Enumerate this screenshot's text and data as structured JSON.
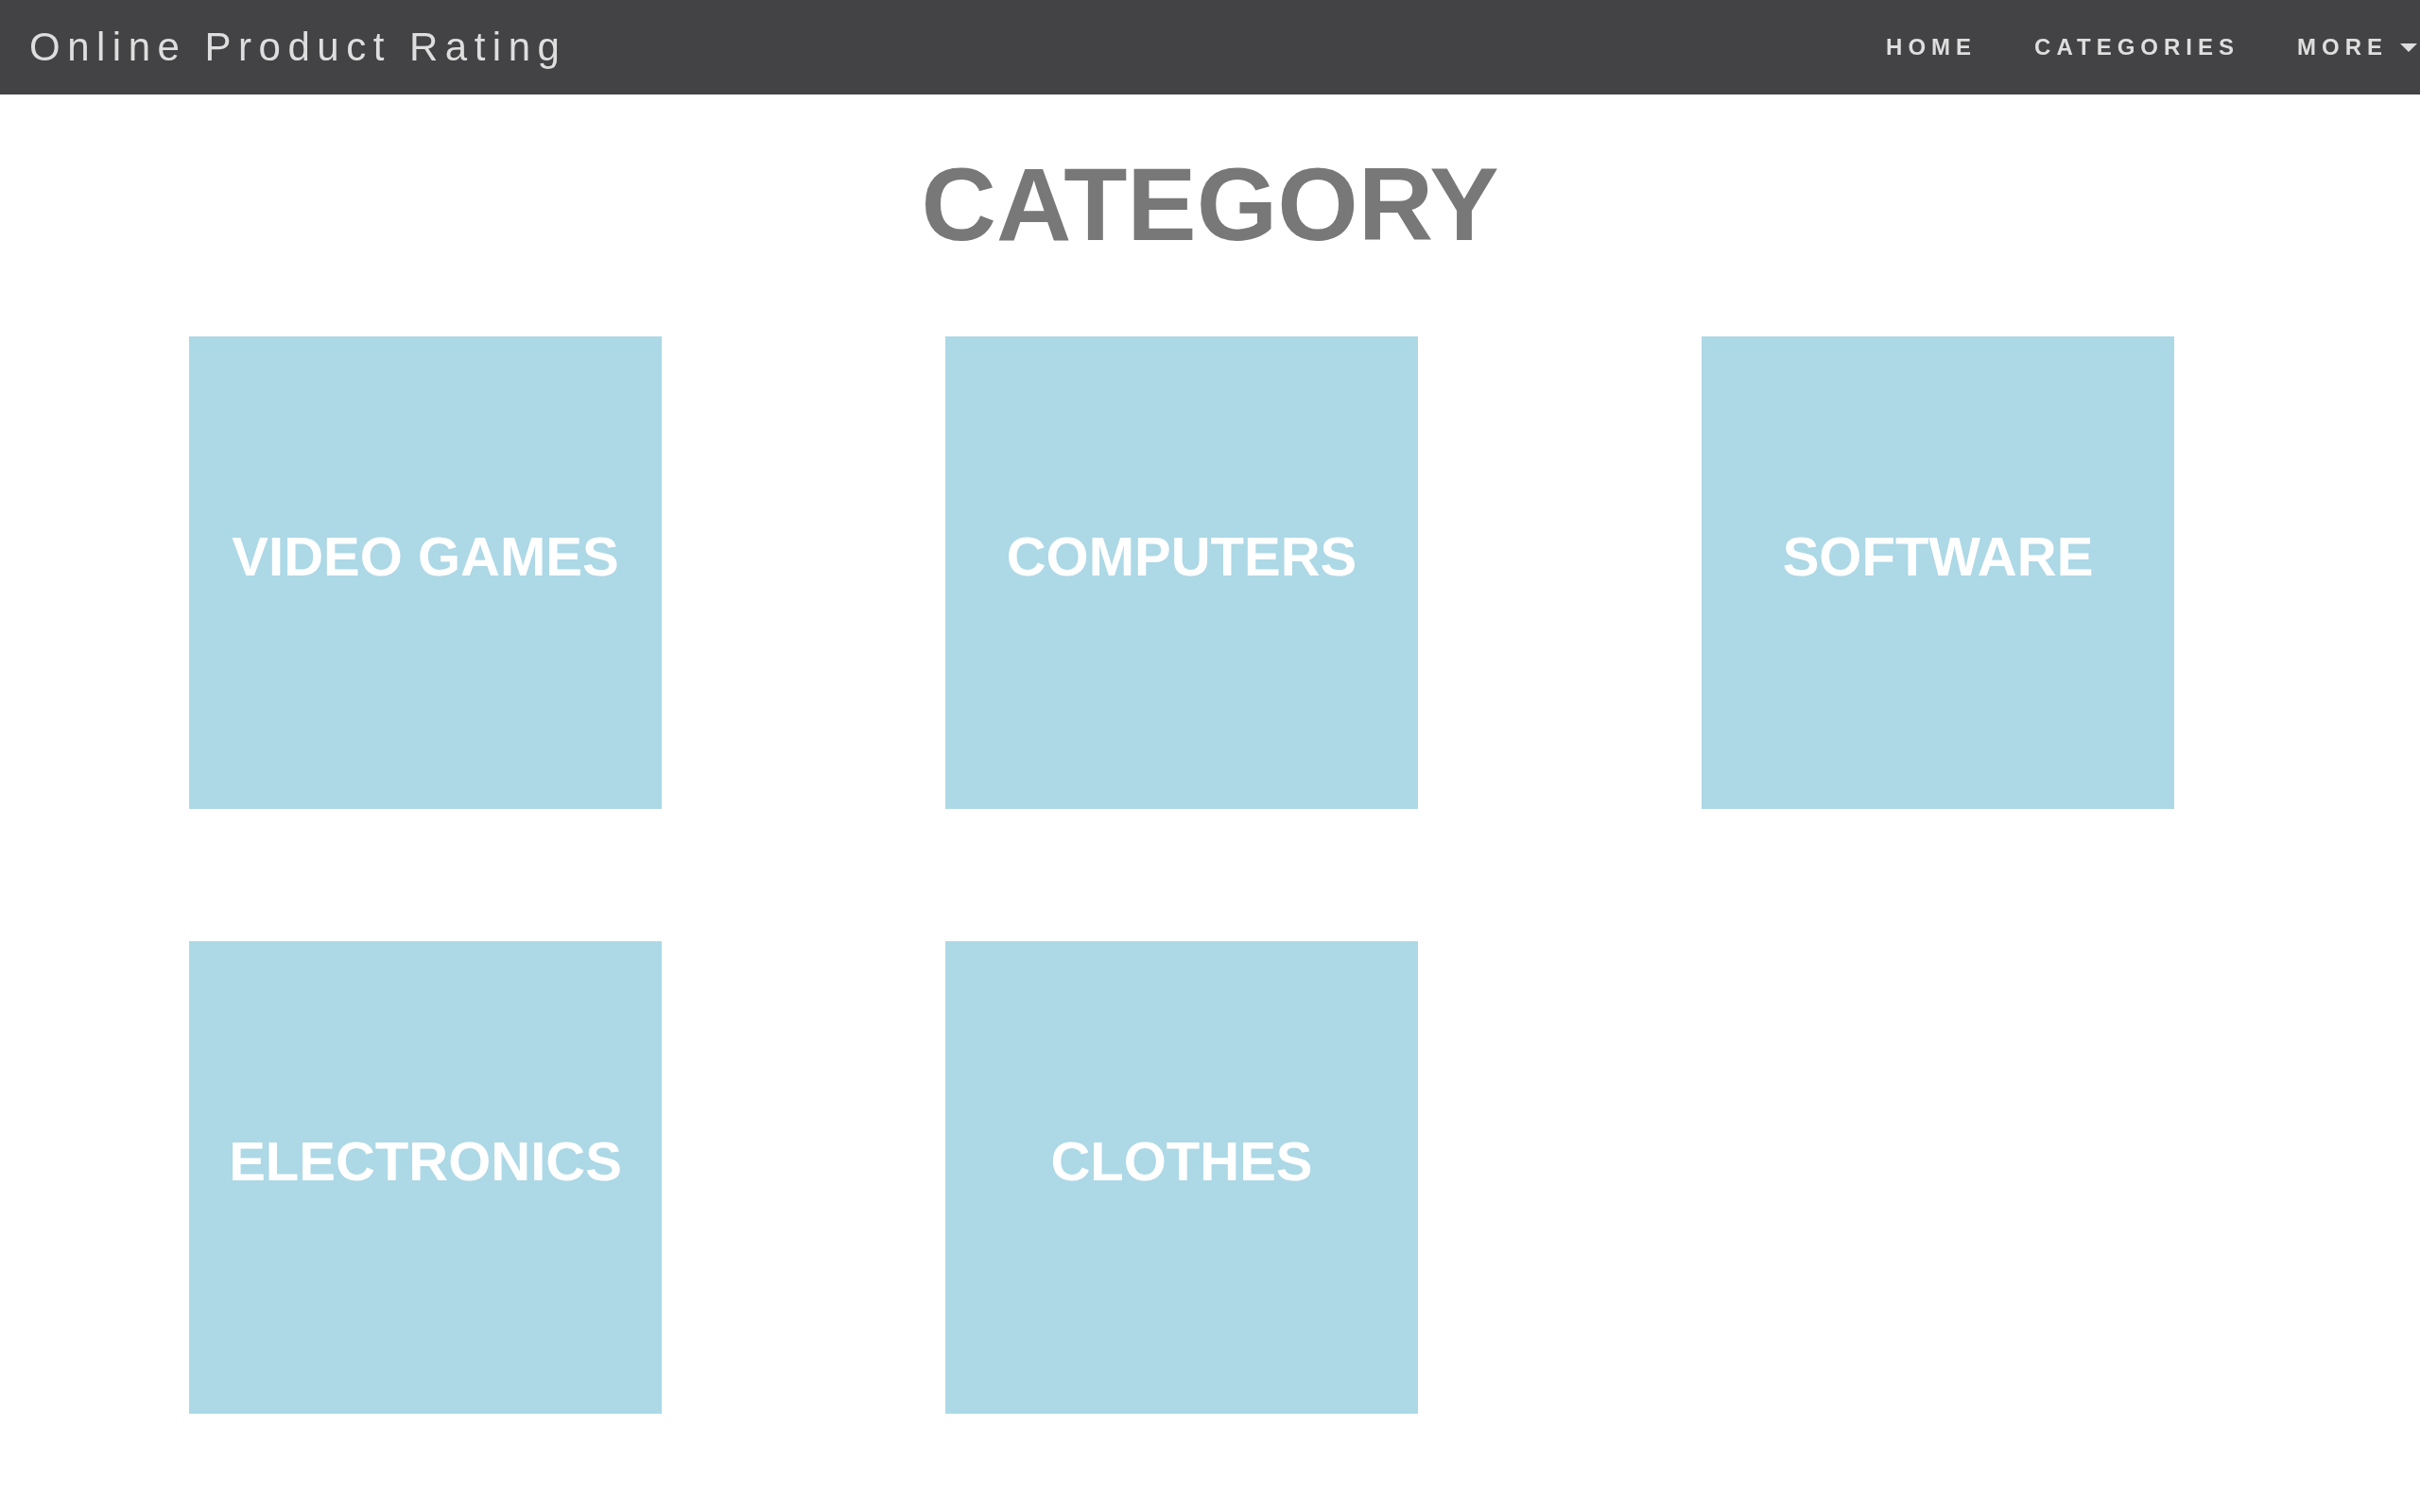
{
  "navbar": {
    "brand": "Online Product Rating",
    "links": [
      {
        "label": "HOME",
        "kind": "link"
      },
      {
        "label": "CATEGORIES",
        "kind": "link"
      },
      {
        "label": "MORE",
        "kind": "dropdown"
      }
    ]
  },
  "heading": "CATEGORY",
  "categories": [
    "VIDEO GAMES",
    "COMPUTERS",
    "SOFTWARE",
    "ELECTRONICS",
    "CLOTHES"
  ]
}
